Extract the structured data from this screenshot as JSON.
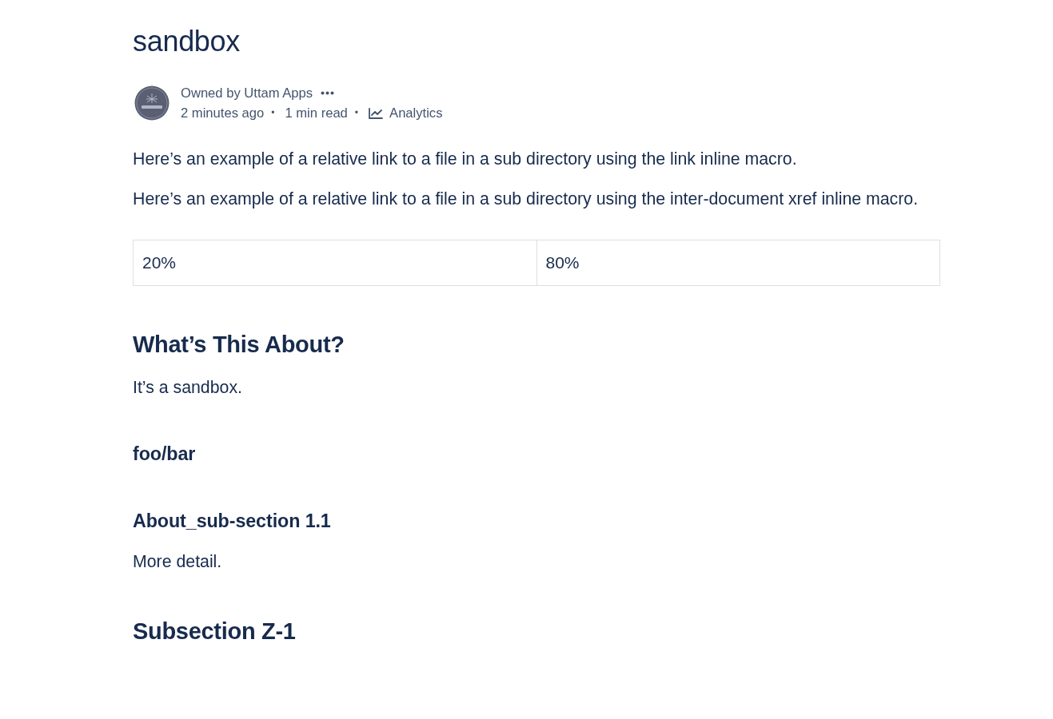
{
  "page": {
    "title": "sandbox"
  },
  "byline": {
    "owner": "Owned by Uttam Apps",
    "meta": [
      {
        "kind": "text",
        "text": "2 minutes ago"
      },
      {
        "kind": "separator",
        "text": "•"
      },
      {
        "kind": "text",
        "text": "1 min read"
      },
      {
        "kind": "separator",
        "text": "•"
      },
      {
        "kind": "link",
        "text": "Analytics"
      }
    ]
  },
  "body": [
    {
      "kind": "paragraph",
      "text": "Here’s an example of a relative link to a file in a sub directory using the link inline macro."
    },
    {
      "kind": "paragraph",
      "text": "Here’s an example of a relative link to a file in a sub directory using the inter-document xref inline macro."
    },
    {
      "kind": "table",
      "cells": [
        "20%",
        "80%"
      ]
    },
    {
      "kind": "h2",
      "text": "What’s This About?"
    },
    {
      "kind": "paragraph",
      "text": "It’s a sandbox."
    },
    {
      "kind": "h3",
      "text": "foo/bar"
    },
    {
      "kind": "h3",
      "text": "About_sub-section 1.1"
    },
    {
      "kind": "paragraph",
      "text": "More detail."
    },
    {
      "kind": "h2",
      "text": "Subsection Z-1"
    }
  ]
}
